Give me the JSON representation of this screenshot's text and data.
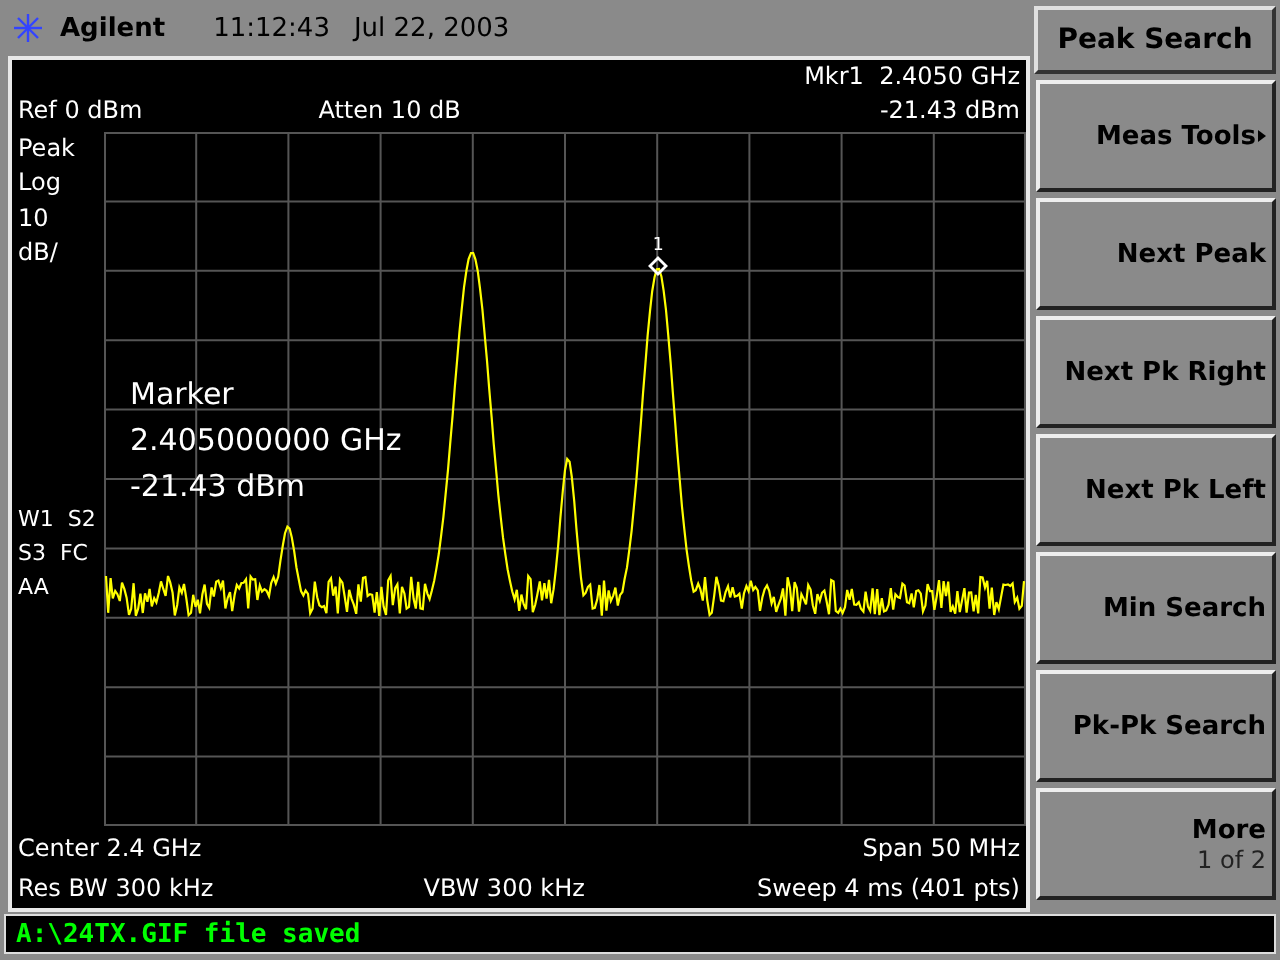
{
  "header": {
    "logo": "Agilent",
    "time": "11:12:43",
    "date": "Jul 22, 2003"
  },
  "readout": {
    "marker": "Mkr1  2.4050 GHz",
    "ref": "Ref 0 dBm",
    "atten": "Atten 10 dB",
    "marker_level": "-21.43 dBm"
  },
  "scale_labels": [
    "Peak",
    "Log",
    "10",
    "dB/"
  ],
  "trace_labels": [
    "W1  S2",
    "S3  FC",
    "AA"
  ],
  "marker_box": [
    "Marker",
    "2.405000000 GHz",
    "-21.43 dBm"
  ],
  "marker_label": "1",
  "footer": {
    "center": "Center 2.4 GHz",
    "span": "Span 50 MHz",
    "rbw": "Res BW 300 kHz",
    "vbw": "VBW 300 kHz",
    "sweep": "Sweep 4 ms (401 pts)"
  },
  "softkeys": {
    "title": "Peak Search",
    "keys": [
      {
        "label": "Meas Tools",
        "submenu": true
      },
      {
        "label": "Next Peak",
        "submenu": false
      },
      {
        "label": "Next Pk Right",
        "submenu": false
      },
      {
        "label": "Next Pk Left",
        "submenu": false
      },
      {
        "label": "Min Search",
        "submenu": false
      },
      {
        "label": "Pk-Pk Search",
        "submenu": false
      },
      {
        "label": "More",
        "submenu": false,
        "sub": "1 of 2"
      }
    ]
  },
  "status": "A:\\24TX.GIF file saved"
}
